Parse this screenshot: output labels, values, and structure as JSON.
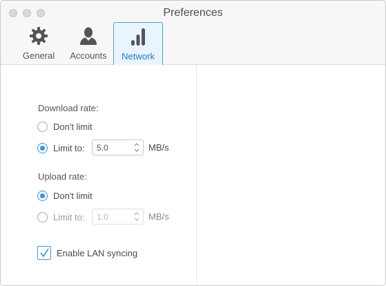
{
  "window": {
    "title": "Preferences"
  },
  "tabs": [
    {
      "label": "General",
      "icon": "gear-icon",
      "selected": false
    },
    {
      "label": "Accounts",
      "icon": "user-icon",
      "selected": false
    },
    {
      "label": "Network",
      "icon": "signal-bars-icon",
      "selected": true
    }
  ],
  "download": {
    "label": "Download rate:",
    "options": [
      {
        "label": "Don't limit",
        "selected": false
      },
      {
        "label": "Limit to:",
        "selected": true
      }
    ],
    "limit_value": "5.0",
    "unit": "MB/s"
  },
  "upload": {
    "label": "Upload rate:",
    "options": [
      {
        "label": "Don't limit",
        "selected": true
      },
      {
        "label": "Limit to:",
        "selected": false
      }
    ],
    "limit_value": "1.0",
    "unit": "MB/s"
  },
  "lan_sync": {
    "label": "Enable LAN syncing",
    "checked": true
  },
  "colors": {
    "accent": "#2f93de",
    "selected_tab_bg": "#e9f4fc",
    "selected_tab_border": "#49a5df"
  }
}
